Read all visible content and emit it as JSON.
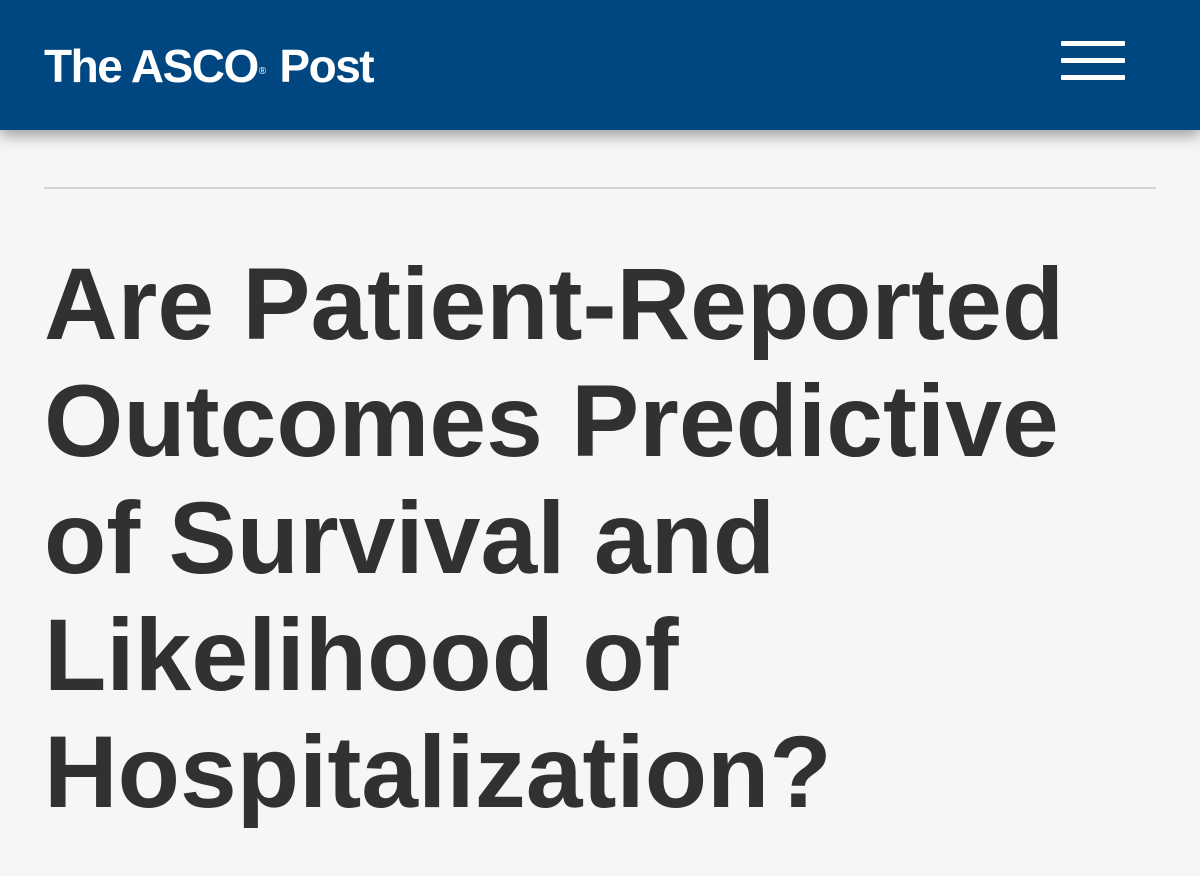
{
  "header": {
    "logo": {
      "prefix": "The ASCO",
      "registered_mark": "®",
      "suffix": " Post"
    },
    "menu_icon": "hamburger-menu-icon",
    "background_color": "#004680"
  },
  "article": {
    "title": "Are Patient-Reported Outcomes Predictive of Survival and Likelihood of Hospitalization?",
    "title_color": "#313131"
  },
  "page": {
    "background_color": "#f6f6f6",
    "divider_color": "#d3d3d3"
  }
}
